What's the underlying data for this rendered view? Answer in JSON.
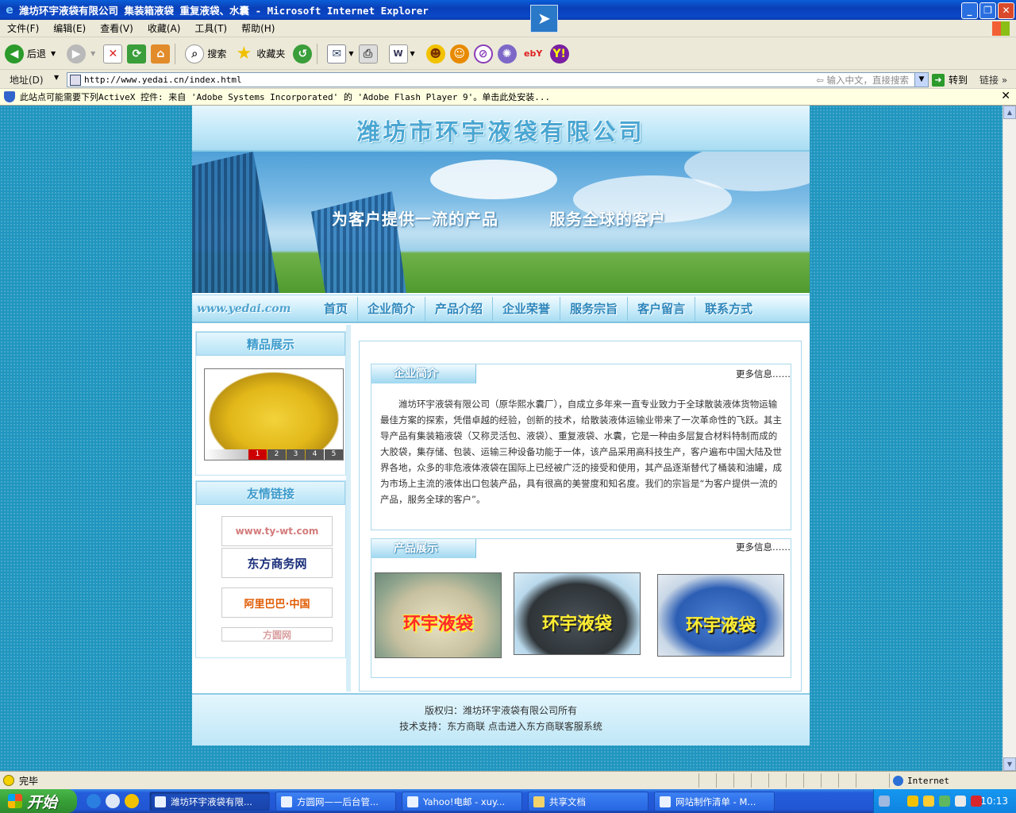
{
  "window": {
    "title": "潍坊环宇液袋有限公司 集装箱液袋 重复液袋、水囊 - Microsoft Internet Explorer"
  },
  "menu": [
    "文件(F)",
    "编辑(E)",
    "查看(V)",
    "收藏(A)",
    "工具(T)",
    "帮助(H)"
  ],
  "toolbar": {
    "back": "后退",
    "search": "搜索",
    "favorites": "收藏夹"
  },
  "address": {
    "label": "地址(D)",
    "url": "http://www.yedai.cn/index.html",
    "hint": "输入中文，直接搜索",
    "go": "转到",
    "links": "链接"
  },
  "infobar": {
    "text": "此站点可能需要下列ActiveX 控件: 来自 'Adobe Systems Incorporated' 的 'Adobe Flash Player 9'。单击此处安装..."
  },
  "site": {
    "company": "潍坊市环宇液袋有限公司",
    "slogan1": "为客户提供一流的产品",
    "slogan2": "服务全球的客户",
    "nav_site": "www.yedai.com",
    "nav": [
      "首页",
      "企业简介",
      "产品介绍",
      "企业荣誉",
      "服务宗旨",
      "客户留言",
      "联系方式"
    ],
    "featured_title": "精品展示",
    "pager": [
      "1",
      "2",
      "3",
      "4",
      "5"
    ],
    "links_title": "友情链接",
    "link_logos": [
      "www.ty-wt.com",
      "东方商务网",
      "阿里巴巴·中国",
      "方圆网"
    ],
    "about_title": "企业简介",
    "more": "更多信息……",
    "about_text": "潍坊环宇液袋有限公司（原华熙水囊厂），自成立多年来一直专业致力于全球散装液体货物运输最佳方案的探索，凭借卓越的经验，创新的技术，给散装液体运输业带来了一次革命性的飞跃。其主导产品有集装箱液袋（又称灵活包、液袋）、重复液袋、水囊，它是一种由多层复合材料特制而成的大胶袋，集存储、包装、运输三种设备功能于一体，该产品采用高科技生产，客户遍布中国大陆及世界各地，众多的非危液体液袋在国际上已经被广泛的接受和使用，其产品逐渐替代了桶装和油罐，成为市场上主流的液体出口包装产品，具有很高的美誉度和知名度。我们的宗旨是“为客户提供一流的产品，服务全球的客户”。",
    "products_title": "产品展示",
    "product_caption": "环宇液袋",
    "footer1": "版权归：潍坊环宇液袋有限公司所有",
    "footer2": "技术支持：东方商联 点击进入东方商联客服系统"
  },
  "status": {
    "text": "完毕",
    "zone": "Internet"
  },
  "taskbar": {
    "start": "开始",
    "tasks": [
      "潍坊环宇液袋有限...",
      "方圆网——后台管...",
      "Yahoo!电邮 - xuy...",
      "共享文档",
      "网站制作清单 - M..."
    ],
    "clock": "10:13"
  }
}
